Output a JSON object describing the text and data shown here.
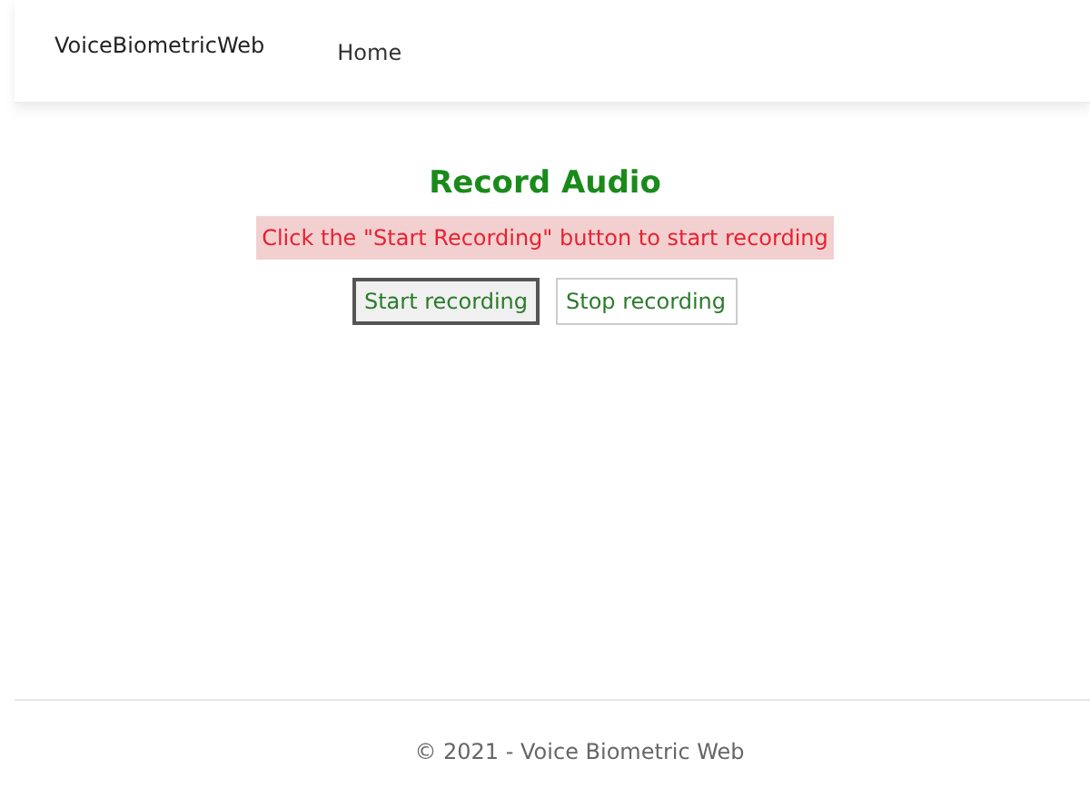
{
  "navbar": {
    "brand": "VoiceBiometricWeb",
    "links": [
      {
        "label": "Home"
      }
    ]
  },
  "main": {
    "title": "Record Audio",
    "message": "Click the \"Start Recording\" button to start recording",
    "buttons": [
      {
        "label": "Start recording",
        "focused": true
      },
      {
        "label": "Stop recording",
        "focused": false
      }
    ]
  },
  "footer": {
    "text": "© 2021 - Voice Biometric Web"
  }
}
